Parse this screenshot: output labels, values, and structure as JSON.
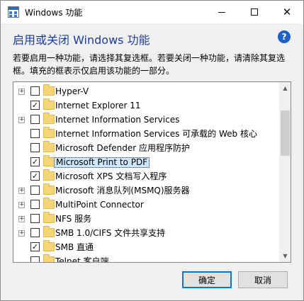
{
  "window": {
    "title": "Windows 功能"
  },
  "titlebar_buttons": {
    "minimize_icon": "minimize-icon",
    "maximize_icon": "maximize-icon",
    "close_glyph": "✕"
  },
  "header": {
    "title": "启用或关闭 Windows 功能",
    "help_glyph": "?"
  },
  "description": "若要启用一种功能，请选择其复选框。若要关闭一种功能，请清除其复选框。填充的框表示仅启用该功能的一部分。",
  "features": [
    {
      "label": "Hyper-V",
      "expandable": true,
      "checked": false,
      "selected": false
    },
    {
      "label": "Internet Explorer 11",
      "expandable": false,
      "checked": true,
      "selected": false
    },
    {
      "label": "Internet Information Services",
      "expandable": true,
      "checked": false,
      "selected": false
    },
    {
      "label": "Internet Information Services 可承载的 Web 核心",
      "expandable": false,
      "checked": false,
      "selected": false
    },
    {
      "label": "Microsoft Defender 应用程序防护",
      "expandable": false,
      "checked": false,
      "selected": false
    },
    {
      "label": "Microsoft Print to PDF",
      "expandable": false,
      "checked": true,
      "selected": true
    },
    {
      "label": "Microsoft XPS 文档写入程序",
      "expandable": false,
      "checked": true,
      "selected": false
    },
    {
      "label": "Microsoft 消息队列(MSMQ)服务器",
      "expandable": true,
      "checked": false,
      "selected": false
    },
    {
      "label": "MultiPoint Connector",
      "expandable": true,
      "checked": false,
      "selected": false
    },
    {
      "label": "NFS 服务",
      "expandable": true,
      "checked": false,
      "selected": false
    },
    {
      "label": "SMB 1.0/CIFS 文件共享支持",
      "expandable": true,
      "checked": false,
      "selected": false
    },
    {
      "label": "SMB 直通",
      "expandable": false,
      "checked": true,
      "selected": false
    },
    {
      "label": "Telnet 客户端",
      "expandable": false,
      "checked": false,
      "selected": false
    }
  ],
  "glyphs": {
    "expander": "+",
    "check": "✓",
    "scroll_up": "▲",
    "scroll_down": "▼"
  },
  "buttons": {
    "ok": "确定",
    "cancel": "取消"
  },
  "colors": {
    "header_text": "#1e3f99",
    "selection": "#cce8ff",
    "help_icon": "#1d62c9",
    "folder": "#f6d47a",
    "default_button_border": "#0078d7"
  }
}
